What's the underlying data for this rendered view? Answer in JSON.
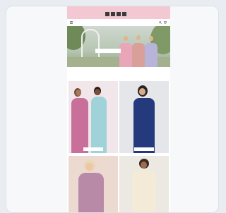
{
  "topbar": {
    "promo": "",
    "countdown": [
      "",
      "",
      "",
      ""
    ]
  },
  "header": {
    "brand": ""
  },
  "hero": {
    "cta": ""
  },
  "section": {
    "title": "",
    "subtitle": ""
  },
  "tiles": [
    {
      "label": ""
    },
    {
      "label": ""
    },
    {
      "label": ""
    },
    {
      "label": ""
    }
  ],
  "colors": {
    "promo_bar": "#f3c8d3",
    "accent": "#8a3850"
  }
}
